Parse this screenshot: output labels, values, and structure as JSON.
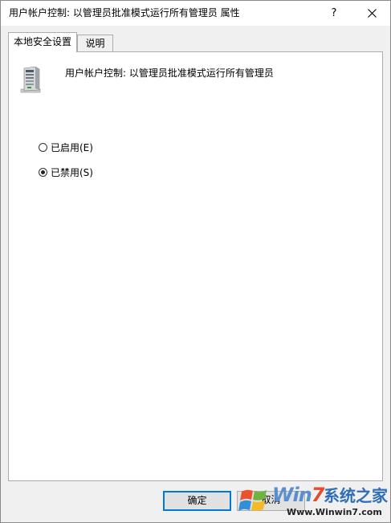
{
  "window": {
    "title": "用户帐户控制: 以管理员批准模式运行所有管理员 属性",
    "help_label": "?",
    "close_icon": "close-icon"
  },
  "tabs": [
    {
      "label": "本地安全设置",
      "active": true
    },
    {
      "label": "说明",
      "active": false
    }
  ],
  "policy": {
    "name": "用户帐户控制: 以管理员批准模式运行所有管理员",
    "icon": "server-icon"
  },
  "options": [
    {
      "label": "已启用(E)",
      "checked": false
    },
    {
      "label": "已禁用(S)",
      "checked": true
    }
  ],
  "buttons": {
    "ok_label": "确定",
    "cancel_label": "取消"
  },
  "watermark": {
    "brand_prefix": "Win",
    "brand_seven": "7",
    "brand_cn": "系统之家",
    "url": "Www.Winwin7.com"
  },
  "colors": {
    "accent": "#0078d7",
    "watermark_blue": "#2f6db6",
    "watermark_red": "#e44b2c"
  }
}
